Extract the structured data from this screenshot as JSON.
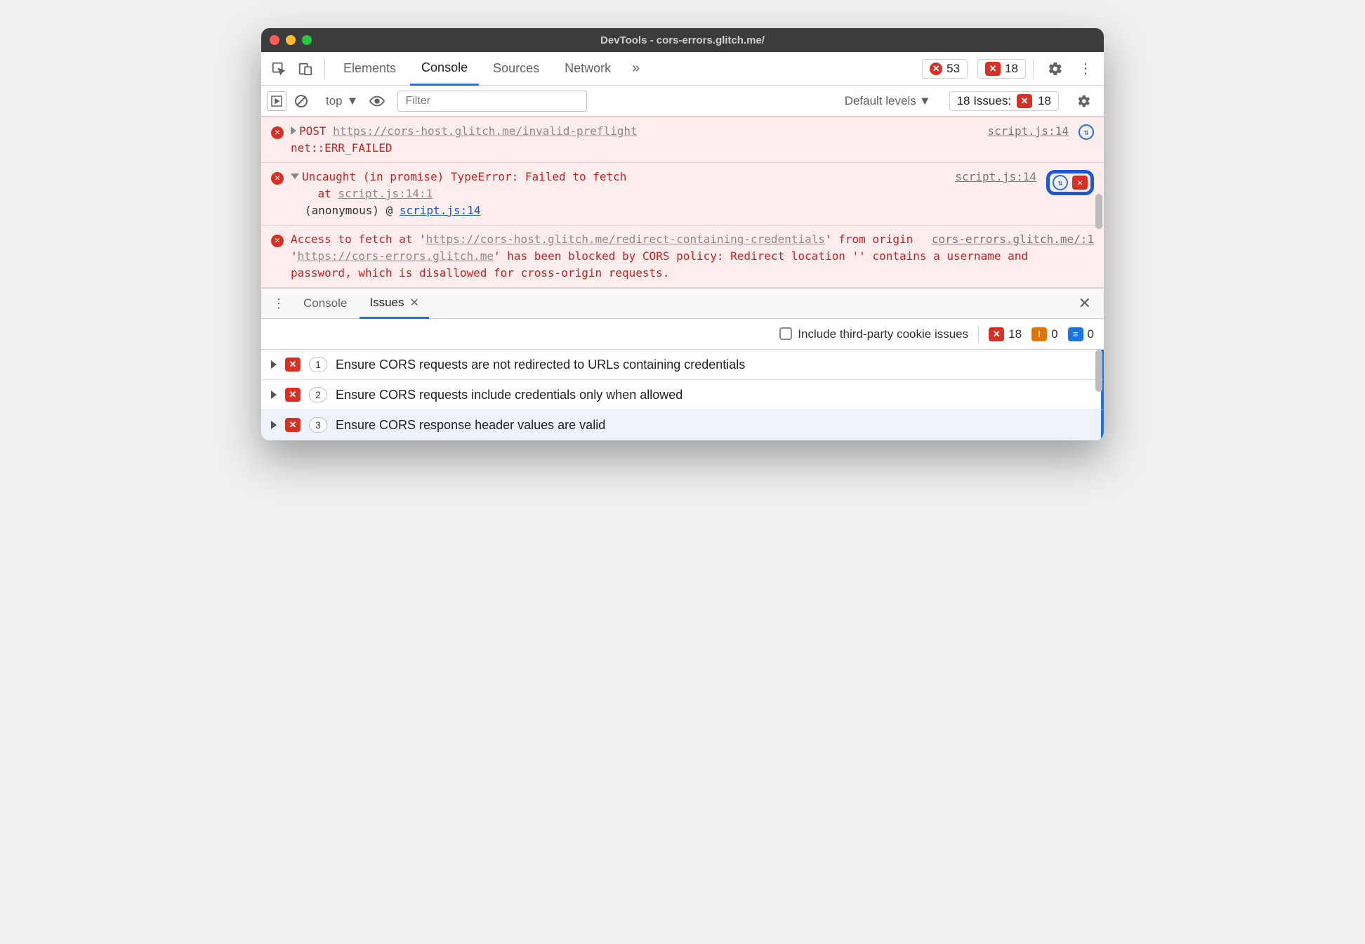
{
  "titlebar": {
    "title": "DevTools - cors-errors.glitch.me/"
  },
  "tabs": {
    "elements": "Elements",
    "console": "Console",
    "sources": "Sources",
    "network": "Network"
  },
  "badges": {
    "errors": "53",
    "issues": "18"
  },
  "toolbar": {
    "context": "top",
    "filter_placeholder": "Filter",
    "levels": "Default levels",
    "issues_label": "18 Issues:",
    "issues_count": "18"
  },
  "console": {
    "msg1_method": "POST",
    "msg1_url": "https://cors-host.glitch.me/invalid-preflight",
    "msg1_err": "net::ERR_FAILED",
    "msg1_src": "script.js:14",
    "msg2_head": "Uncaught (in promise) TypeError: Failed to fetch",
    "msg2_at": "at ",
    "msg2_atlink": "script.js:14:1",
    "msg2_anon": "(anonymous)",
    "msg2_atsym": "@",
    "msg2_link": "script.js:14",
    "msg2_src": "script.js:14",
    "msg3_pre": "Access to fetch at '",
    "msg3_url1a": "https://cors-host.glitch.me/redi",
    "msg3_url1b": "rect-containing-credentials",
    "msg3_mid": "' from origin '",
    "msg3_url2": "https://cors-errors.glitch.me",
    "msg3_tail": "' has been blocked by CORS policy: Redirect location '' contains a username and password, which is disallowed for cross-origin requests.",
    "msg3_src": "cors-errors.glitch.me/:1"
  },
  "drawer": {
    "console": "Console",
    "issues": "Issues",
    "cookie_label": "Include third-party cookie issues",
    "counts": {
      "err": "18",
      "warn": "0",
      "info": "0"
    },
    "items": [
      {
        "count": "1",
        "text": "Ensure CORS requests are not redirected to URLs containing credentials"
      },
      {
        "count": "2",
        "text": "Ensure CORS requests include credentials only when allowed"
      },
      {
        "count": "3",
        "text": "Ensure CORS response header values are valid"
      }
    ]
  }
}
